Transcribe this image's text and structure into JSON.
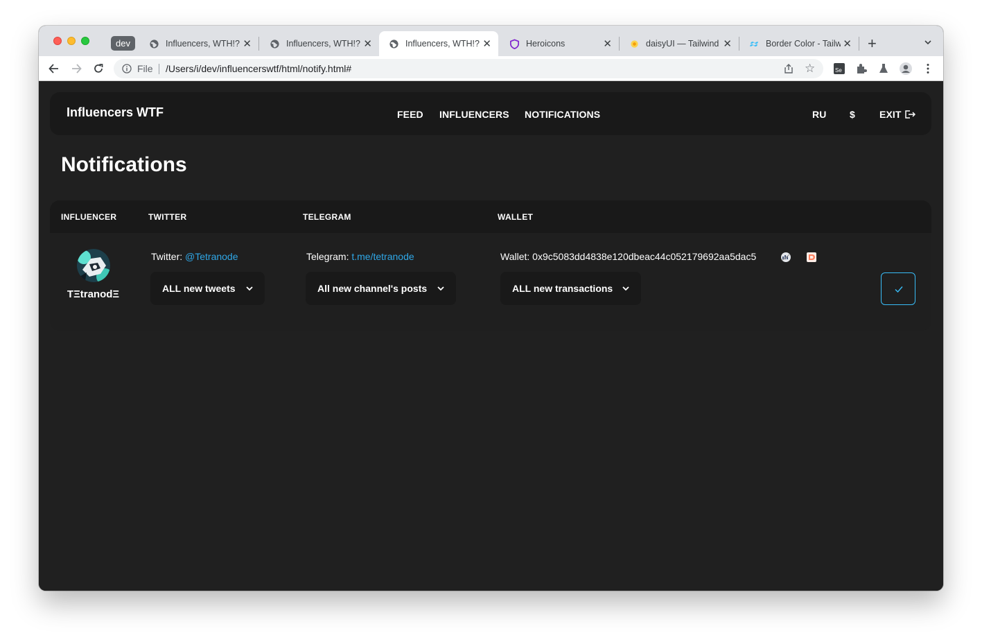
{
  "browser": {
    "profile_chip": "dev",
    "tabs": [
      {
        "label": "Influencers, WTH!?",
        "icon": "globe-icon",
        "active": false
      },
      {
        "label": "Influencers, WTH!?",
        "icon": "globe-icon",
        "active": false
      },
      {
        "label": "Influencers, WTH!?",
        "icon": "globe-icon",
        "active": true
      },
      {
        "label": "Heroicons",
        "icon": "heroicons-shield-icon",
        "active": false
      },
      {
        "label": "daisyUI — Tailwind",
        "icon": "daisyui-flower-icon",
        "active": false
      },
      {
        "label": "Border Color - Tailw",
        "icon": "tailwind-icon",
        "active": false
      }
    ],
    "address": {
      "scheme_label": "File",
      "url": "/Users/i/dev/influencerswtf/html/notify.html#"
    }
  },
  "app": {
    "brand": "Influencers WTF",
    "nav": {
      "feed": "FEED",
      "influencers": "INFLUENCERS",
      "notifications": "NOTIFICATIONS",
      "language": "RU",
      "currency": "$",
      "exit": "EXIT"
    },
    "page_title": "Notifications",
    "table": {
      "headers": {
        "influencer": "INFLUENCER",
        "twitter": "TWITTER",
        "telegram": "TELEGRAM",
        "wallet": "WALLET"
      },
      "rows": [
        {
          "influencer_name": "TΞtranodΞ",
          "twitter_prefix": "Twitter:",
          "twitter_handle": "@Tetranode",
          "twitter_option": "ALL new tweets",
          "telegram_prefix": "Telegram:",
          "telegram_link": "t.me/tetranode",
          "telegram_option": "All new channel's posts",
          "wallet_prefix": "Wallet:",
          "wallet_address": "0x9c5083dd4838e120dbeac44c052179692aa5dac5",
          "wallet_option": "ALL new transactions"
        }
      ]
    }
  },
  "colors": {
    "page_bg": "#202020",
    "card_bg": "#191919",
    "link": "#2fa7e7",
    "confirm_border": "#38bdf8"
  }
}
